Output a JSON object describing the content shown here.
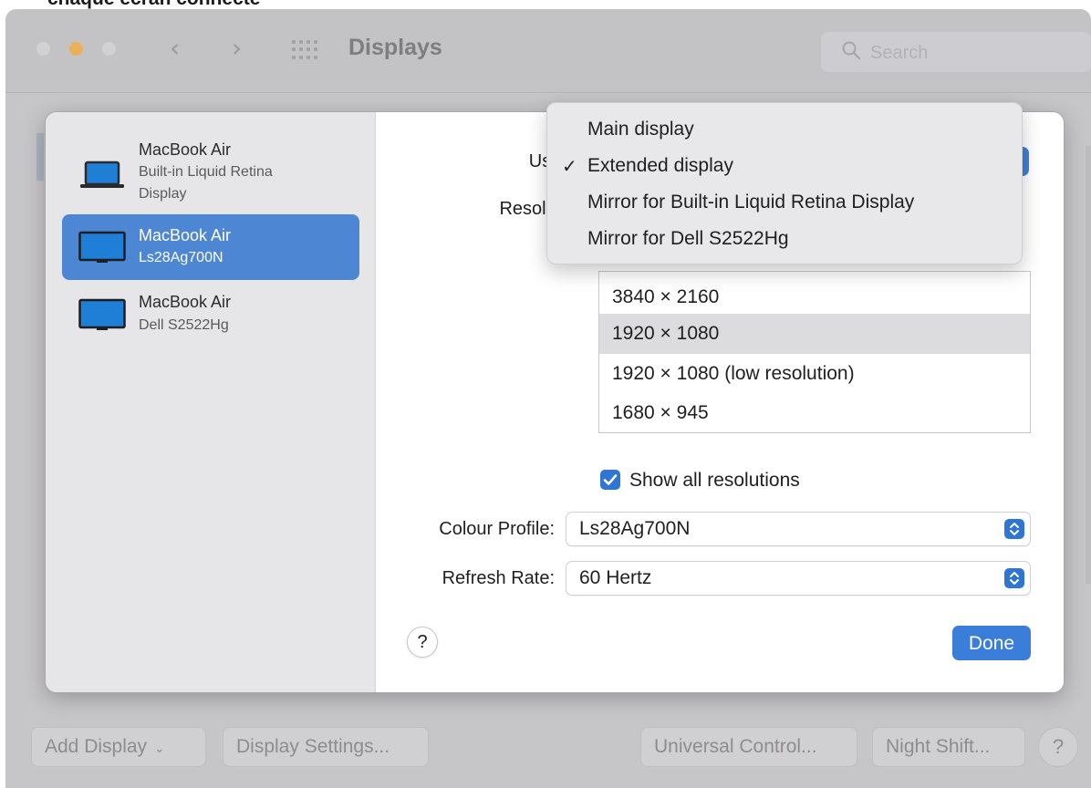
{
  "caption": "chaque écran connecté",
  "window": {
    "title": "Displays",
    "search_placeholder": "Search",
    "traffic_colors": {
      "close": "#d2d1d4",
      "minimize": "#eab05a",
      "zoom": "#d2d1d4"
    }
  },
  "displays": [
    {
      "name": "MacBook Air",
      "subtitle": "Built-in Liquid Retina Display",
      "icon": "laptop-icon",
      "selected": false
    },
    {
      "name": "MacBook Air",
      "subtitle": "Ls28Ag700N",
      "icon": "monitor-icon",
      "selected": true
    },
    {
      "name": "MacBook Air",
      "subtitle": "Dell S2522Hg",
      "icon": "monitor-icon",
      "selected": false
    }
  ],
  "settings": {
    "use_as_label": "Use as",
    "resolution_label": "Resolution",
    "resolutions": [
      "3840 × 2160",
      "1920 × 1080",
      "1920 × 1080 (low resolution)",
      "1680 × 945"
    ],
    "selected_resolution_index": 1,
    "show_all_resolutions_label": "Show all resolutions",
    "show_all_resolutions_checked": true,
    "colour_profile_label": "Colour Profile:",
    "colour_profile_value": "Ls28Ag700N",
    "refresh_rate_label": "Refresh Rate:",
    "refresh_rate_value": "60 Hertz",
    "help_label": "?",
    "done_label": "Done"
  },
  "use_as_menu": {
    "items": [
      "Main display",
      "Extended display",
      "Mirror for Built-in Liquid Retina Display",
      "Mirror for Dell S2522Hg"
    ],
    "checked_index": 1,
    "check_glyph": "✓"
  },
  "footer": {
    "add_display": "Add Display",
    "display_settings": "Display Settings...",
    "universal_control": "Universal Control...",
    "night_shift": "Night Shift...",
    "help": "?"
  },
  "colors": {
    "accent": "#3a7ed9",
    "selection": "#4d87d3",
    "sidebar_bg": "#e6e5e8",
    "menu_bg": "#e8e7ea"
  }
}
